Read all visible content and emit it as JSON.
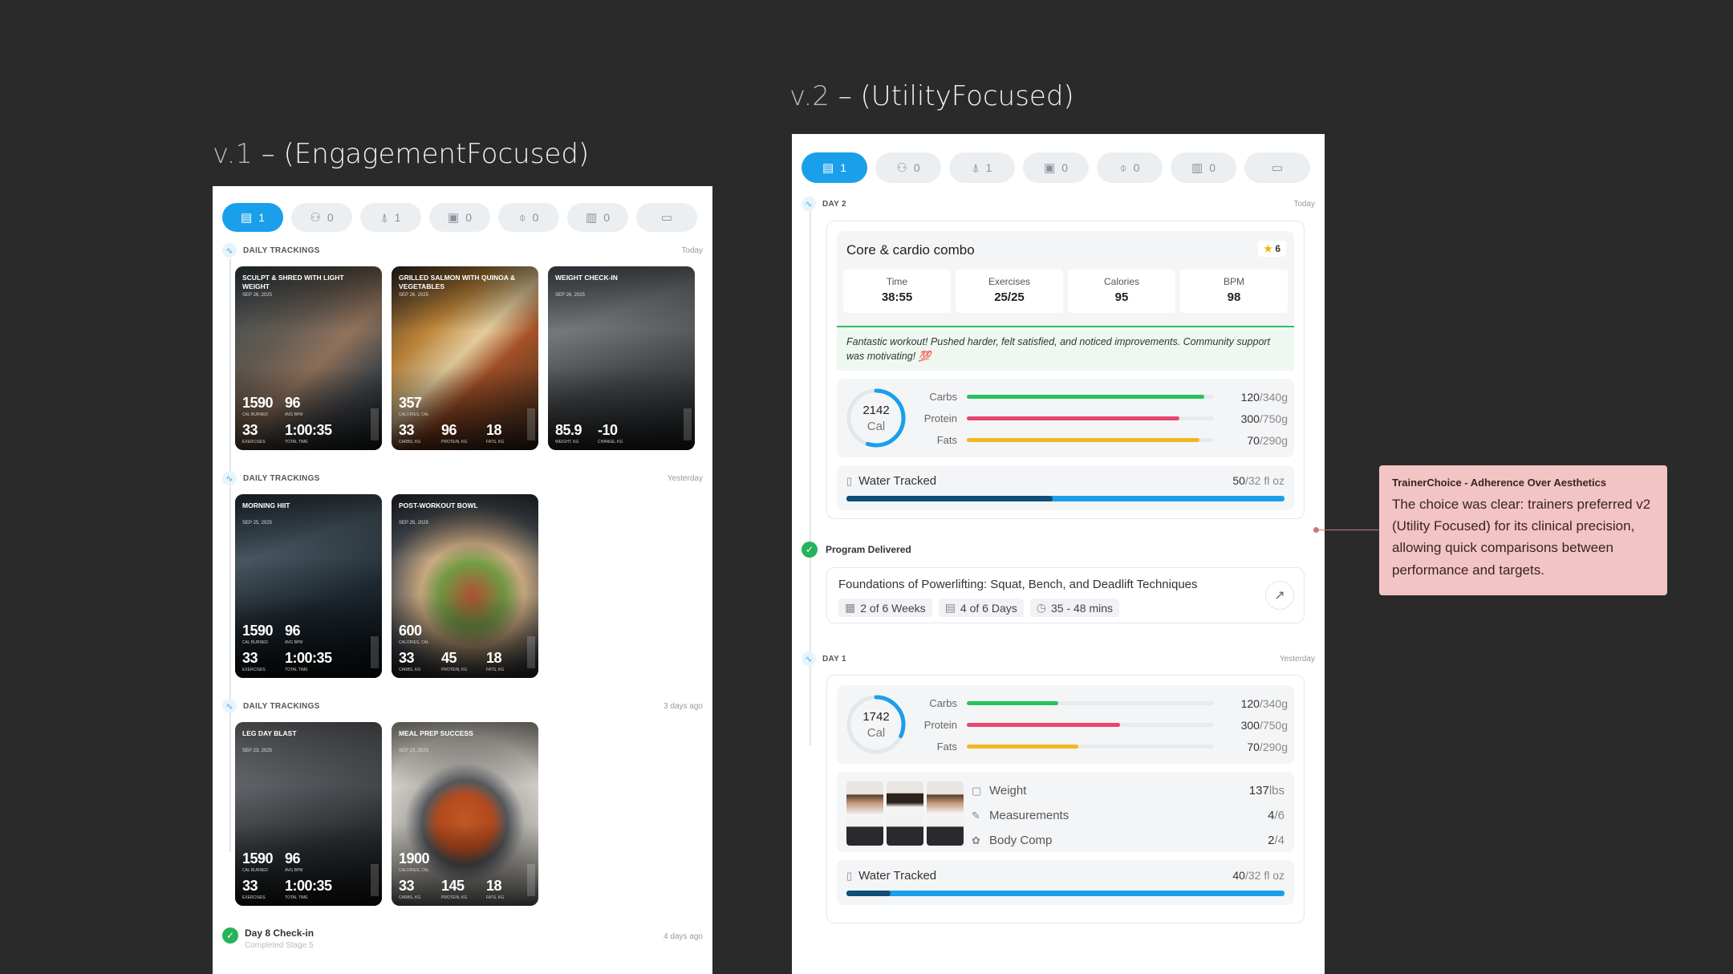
{
  "v1": {
    "title_ver": "v.1",
    "title_rest": " – (EngagementFocused)",
    "tabs": [
      {
        "icon": "tracking-icon",
        "glyph": "▤",
        "count": "1",
        "active": true
      },
      {
        "icon": "dumbbell-icon",
        "glyph": "⚇",
        "count": "0",
        "active": false
      },
      {
        "icon": "meal-icon",
        "glyph": "⍋",
        "count": "1",
        "active": false
      },
      {
        "icon": "calendar-icon",
        "glyph": "▣",
        "count": "0",
        "active": false
      },
      {
        "icon": "water-drop-icon",
        "glyph": "⌽",
        "count": "0",
        "active": false
      },
      {
        "icon": "clipboard-icon",
        "glyph": "▥",
        "count": "0",
        "active": false
      },
      {
        "icon": "folder-icon",
        "glyph": "▭",
        "count": "",
        "active": false
      }
    ],
    "sections": [
      {
        "label": "DAILY TRACKINGS",
        "when": "Today"
      },
      {
        "label": "DAILY TRACKINGS",
        "when": "Yesterday"
      },
      {
        "label": "DAILY TRACKINGS",
        "when": "3 days ago"
      }
    ],
    "cards": [
      {
        "title": "SCULPT & SHRED WITH LIGHT WEIGHT",
        "date": "SEP 26, 2025",
        "tl": "1590",
        "tl_l": "CAL BURNED",
        "tr": "96",
        "tr_l": "AVG BPM",
        "bl": "33",
        "bl_l": "EXERCISES",
        "br": "1:00:35",
        "br_l": "TOTAL TIME",
        "bg": "gym"
      },
      {
        "title": "GRILLED SALMON WITH QUINOA & VEGETABLES",
        "date": "SEP 26, 2025",
        "tl": "357",
        "tl_l": "CALORIES, CAL",
        "bl": "33",
        "bl_l": "CARBS, KG",
        "bm": "96",
        "bm_l": "PROTEIN, KG",
        "br": "18",
        "br_l": "FATS, KG",
        "bg": "food"
      },
      {
        "title": "WEIGHT CHECK-IN",
        "date": "SEP 26, 2025",
        "bl": "85.9",
        "bl_l": "WEIGHT, KG",
        "bm": "-10",
        "bm_l": "CHANGE, KG",
        "bg": "gym2"
      },
      {
        "title": "MORNING HIIT",
        "date": "SEP 25, 2025",
        "tl": "1590",
        "tl_l": "CAL BURNED",
        "tr": "96",
        "tr_l": "AVG BPM",
        "bl": "33",
        "bl_l": "EXERCISES",
        "br": "1:00:35",
        "br_l": "TOTAL TIME",
        "bg": "hiit"
      },
      {
        "title": "POST-WORKOUT BOWL",
        "date": "SEP 25, 2025",
        "tl": "600",
        "tl_l": "CALORIES, CAL",
        "bl": "33",
        "bl_l": "CARBS, KG",
        "bm": "45",
        "bm_l": "PROTEIN, KG",
        "br": "18",
        "br_l": "FATS, KG",
        "bg": "bowl"
      },
      {
        "title": "LEG DAY BLAST",
        "date": "SEP 23, 2025",
        "tl": "1590",
        "tl_l": "CAL BURNED",
        "tr": "96",
        "tr_l": "AVG BPM",
        "bl": "33",
        "bl_l": "EXERCISES",
        "br": "1:00:35",
        "br_l": "TOTAL TIME",
        "bg": "legs"
      },
      {
        "title": "MEAL PREP SUCCESS",
        "date": "SEP 23, 2025",
        "tl": "1900",
        "tl_l": "CALORIES, CAL",
        "bl": "33",
        "bl_l": "CARBS, KG",
        "bm": "145",
        "bm_l": "PROTEIN, KG",
        "br": "18",
        "br_l": "FATS, KG",
        "bg": "soup"
      }
    ],
    "checkin": {
      "label": "Day 8 Check-in",
      "sub": "Completed Stage 5",
      "when": "4 days ago"
    }
  },
  "v2": {
    "title_ver": "v.2",
    "title_rest": " – (UtilityFocused)",
    "day2": {
      "label": "DAY 2",
      "when": "Today"
    },
    "workout": {
      "name": "Core & cardio combo",
      "stars": "6",
      "metrics": [
        {
          "label": "Time",
          "value": "38:55"
        },
        {
          "label": "Exercises",
          "value": "25/25"
        },
        {
          "label": "Calories",
          "value": "95"
        },
        {
          "label": "BPM",
          "value": "98"
        }
      ],
      "comment": "Fantastic workout! Pushed harder, felt satisfied, and noticed improvements. Community support was motivating! 💯"
    },
    "nutrition2": {
      "cal": "2142",
      "cal_unit": "Cal",
      "ring_fraction": 0.55,
      "macros": [
        {
          "name": "Carbs",
          "value": "120",
          "target": "/340g",
          "fraction": 0.96,
          "color": "#27c25c"
        },
        {
          "name": "Protein",
          "value": "300",
          "target": "/750g",
          "fraction": 0.86,
          "color": "#e8456f"
        },
        {
          "name": "Fats",
          "value": "70",
          "target": "/290g",
          "fraction": 0.94,
          "color": "#f4b625"
        }
      ]
    },
    "water2": {
      "label": "Water Tracked",
      "value": "50",
      "target": "/32 fl oz",
      "fraction": 0.47
    },
    "program": {
      "status": "Program Delivered",
      "name": "Foundations of Powerlifting: Squat, Bench, and Deadlift Techniques",
      "chips": [
        "2 of 6 Weeks",
        "4 of 6 Days",
        "35 - 48 mins"
      ]
    },
    "day1": {
      "label": "DAY 1",
      "when": "Yesterday"
    },
    "nutrition1": {
      "cal": "1742",
      "cal_unit": "Cal",
      "ring_fraction": 0.32,
      "macros": [
        {
          "name": "Carbs",
          "value": "120",
          "target": "/340g",
          "fraction": 0.37,
          "color": "#27c25c"
        },
        {
          "name": "Protein",
          "value": "300",
          "target": "/750g",
          "fraction": 0.62,
          "color": "#e8456f"
        },
        {
          "name": "Fats",
          "value": "70",
          "target": "/290g",
          "fraction": 0.45,
          "color": "#f4b625"
        }
      ]
    },
    "body": [
      {
        "icon": "scale-icon",
        "glyph": "▢",
        "label": "Weight",
        "value": "137",
        "unit": "lbs"
      },
      {
        "icon": "ruler-icon",
        "glyph": "✎",
        "label": "Measurements",
        "value": "4",
        "unit": "/6"
      },
      {
        "icon": "body-comp-icon",
        "glyph": "✿",
        "label": "Body Comp",
        "value": "2",
        "unit": "/4"
      }
    ],
    "water1": {
      "label": "Water Tracked",
      "value": "40",
      "target": "/32 fl oz",
      "fraction": 0.1
    }
  },
  "note": {
    "title": "TrainerChoice - Adherence Over Aesthetics",
    "body": "The choice was clear: trainers preferred v2 (Utility Focused) for its clinical precision, allowing quick comparisons between performance and targets."
  }
}
